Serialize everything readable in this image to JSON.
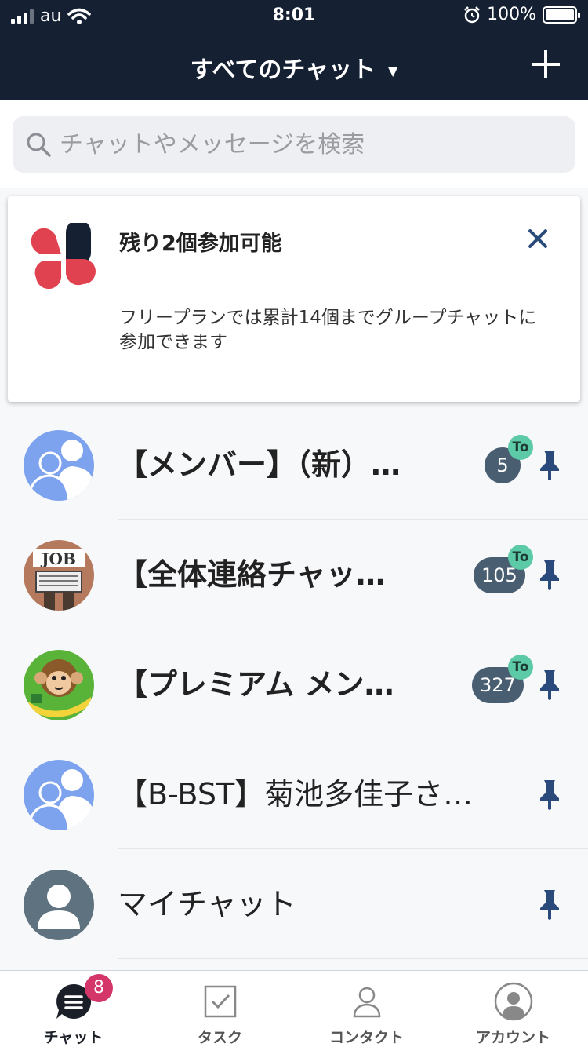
{
  "status_bar": {
    "carrier": "au",
    "time": "8:01",
    "battery": "100%"
  },
  "nav": {
    "title": "すべてのチャット",
    "caret": "▼"
  },
  "search": {
    "placeholder": "チャットやメッセージを検索"
  },
  "notice": {
    "title": "残り2個参加可能",
    "body": "フリープランでは累計14個までグループチャットに参加できます"
  },
  "chats": [
    {
      "name": "【メンバー】（新）…",
      "unread": "5",
      "to": "To",
      "pinned": true
    },
    {
      "name": "【全体連絡チャッ…",
      "unread": "105",
      "to": "To",
      "pinned": true
    },
    {
      "name": "【プレミアム メン…",
      "unread": "327",
      "to": "To",
      "pinned": true
    },
    {
      "name": "【B-BST】菊池多佳子さ…",
      "unread": "",
      "to": "",
      "pinned": true
    },
    {
      "name": "マイチャット",
      "unread": "",
      "to": "",
      "pinned": true
    }
  ],
  "avatar_labels": {
    "job": "JOB"
  },
  "tabs": [
    {
      "label": "チャット",
      "badge": "8",
      "icon": "chat-icon"
    },
    {
      "label": "タスク",
      "icon": "task-icon"
    },
    {
      "label": "コンタクト",
      "icon": "contact-icon"
    },
    {
      "label": "アカウント",
      "icon": "account-icon"
    }
  ],
  "colors": {
    "header": "#152033",
    "badge": "#4a5e71",
    "to_badge": "#5cc9a7",
    "pin": "#2b4a7c",
    "tab_badge": "#d4366a",
    "logo_red": "#e0434f",
    "logo_navy": "#152033"
  }
}
